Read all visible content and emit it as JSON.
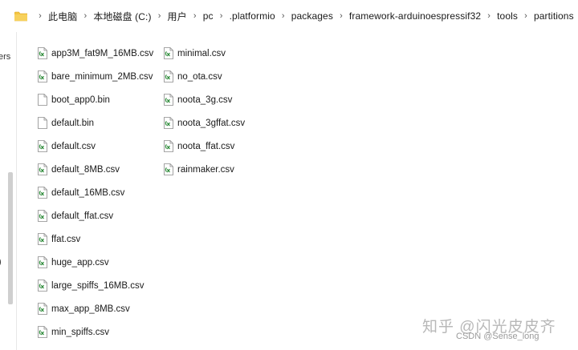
{
  "breadcrumb": {
    "parts": [
      "此电脑",
      "本地磁盘 (C:)",
      "用户",
      "pc",
      ".platformio",
      "packages",
      "framework-arduinoespressif32",
      "tools",
      "partitions"
    ]
  },
  "nav": {
    "frag_top": "ers",
    "frag_mid": ")"
  },
  "files": {
    "column1": [
      {
        "name": "app3M_fat9M_16MB.csv",
        "icon": "csv-file-icon"
      },
      {
        "name": "bare_minimum_2MB.csv",
        "icon": "csv-file-icon"
      },
      {
        "name": "boot_app0.bin",
        "icon": "bin-file-icon"
      },
      {
        "name": "default.bin",
        "icon": "bin-file-icon"
      },
      {
        "name": "default.csv",
        "icon": "csv-file-icon"
      },
      {
        "name": "default_8MB.csv",
        "icon": "csv-file-icon"
      },
      {
        "name": "default_16MB.csv",
        "icon": "csv-file-icon"
      },
      {
        "name": "default_ffat.csv",
        "icon": "csv-file-icon"
      },
      {
        "name": "ffat.csv",
        "icon": "csv-file-icon"
      },
      {
        "name": "huge_app.csv",
        "icon": "csv-file-icon"
      },
      {
        "name": "large_spiffs_16MB.csv",
        "icon": "csv-file-icon"
      },
      {
        "name": "max_app_8MB.csv",
        "icon": "csv-file-icon"
      },
      {
        "name": "min_spiffs.csv",
        "icon": "csv-file-icon"
      }
    ],
    "column2": [
      {
        "name": "minimal.csv",
        "icon": "csv-file-icon"
      },
      {
        "name": "no_ota.csv",
        "icon": "csv-file-icon"
      },
      {
        "name": "noota_3g.csv",
        "icon": "csv-file-icon"
      },
      {
        "name": "noota_3gffat.csv",
        "icon": "csv-file-icon"
      },
      {
        "name": "noota_ffat.csv",
        "icon": "csv-file-icon"
      },
      {
        "name": "rainmaker.csv",
        "icon": "csv-file-icon"
      }
    ]
  },
  "watermark": {
    "line1": "知乎 @闪光皮皮齐",
    "line2": "CSDN @Sense_long"
  },
  "colors": {
    "folder": "#f4c542",
    "csv_icon": "#2e8b3a",
    "accent": "#1a1a1a"
  }
}
